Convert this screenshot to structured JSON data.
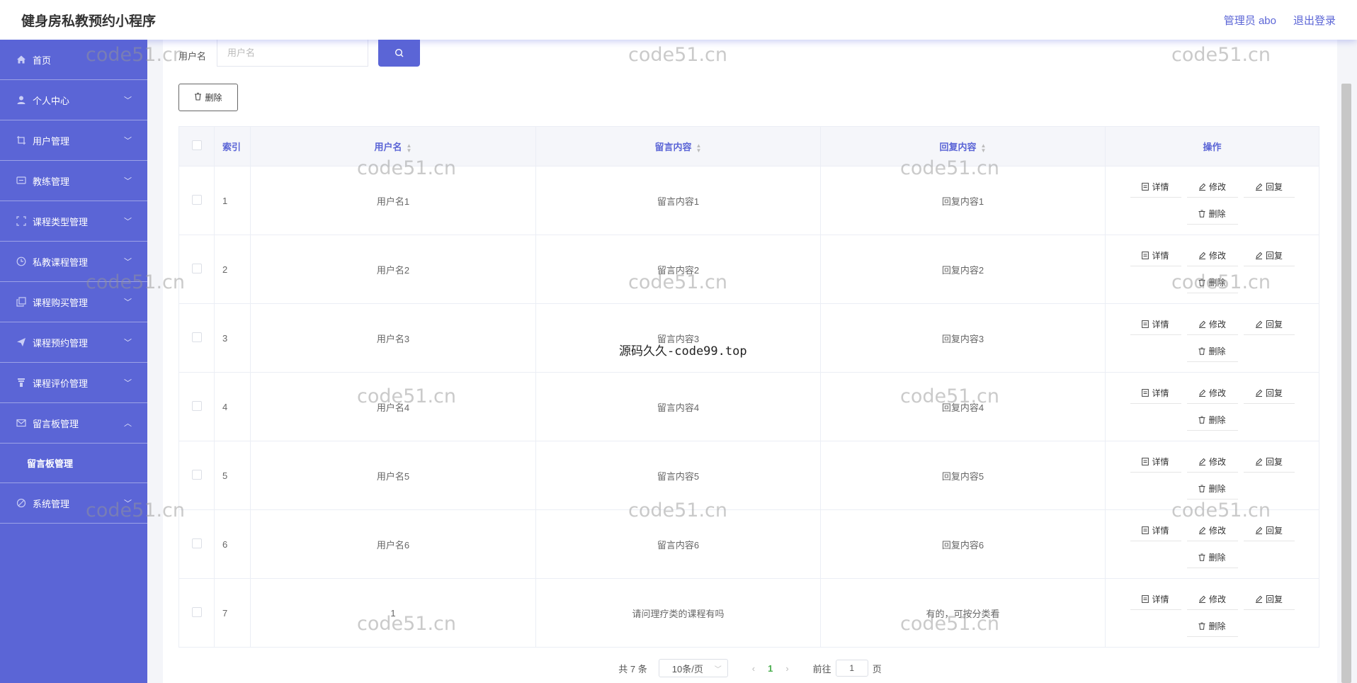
{
  "header": {
    "app_title": "健身房私教预约小程序",
    "user_label": "管理员 abo",
    "logout_label": "退出登录"
  },
  "sidebar": {
    "items": [
      {
        "label": "首页",
        "icon": "home-icon"
      },
      {
        "label": "个人中心",
        "icon": "user-icon"
      },
      {
        "label": "用户管理",
        "icon": "crop-icon"
      },
      {
        "label": "教练管理",
        "icon": "message-icon"
      },
      {
        "label": "课程类型管理",
        "icon": "fullscreen-icon"
      },
      {
        "label": "私教课程管理",
        "icon": "clock-icon"
      },
      {
        "label": "课程购买管理",
        "icon": "copy-icon"
      },
      {
        "label": "课程预约管理",
        "icon": "send-icon"
      },
      {
        "label": "课程评价管理",
        "icon": "trophy-icon"
      },
      {
        "label": "留言板管理",
        "icon": "mail-icon"
      },
      {
        "label": "系统管理",
        "icon": "setting-icon"
      }
    ],
    "submenu": {
      "label": "留言板管理"
    }
  },
  "search": {
    "label": "用户名",
    "placeholder": "用户名"
  },
  "toolbar": {
    "delete_label": "删除"
  },
  "table": {
    "columns": [
      "索引",
      "用户名",
      "留言内容",
      "回复内容",
      "操作"
    ],
    "rows": [
      {
        "index": "1",
        "username": "用户名1",
        "message": "留言内容1",
        "reply": "回复内容1"
      },
      {
        "index": "2",
        "username": "用户名2",
        "message": "留言内容2",
        "reply": "回复内容2"
      },
      {
        "index": "3",
        "username": "用户名3",
        "message": "留言内容3",
        "reply": "回复内容3"
      },
      {
        "index": "4",
        "username": "用户名4",
        "message": "留言内容4",
        "reply": "回复内容4"
      },
      {
        "index": "5",
        "username": "用户名5",
        "message": "留言内容5",
        "reply": "回复内容5"
      },
      {
        "index": "6",
        "username": "用户名6",
        "message": "留言内容6",
        "reply": "回复内容6"
      },
      {
        "index": "7",
        "username": "1",
        "message": "请问理疗类的课程有吗",
        "reply": "有的，可按分类看"
      }
    ],
    "actions": {
      "detail": "详情",
      "edit": "修改",
      "reply": "回复",
      "delete": "删除"
    }
  },
  "pagination": {
    "total": "共 7 条",
    "page_size": "10条/页",
    "current_page": "1",
    "goto_label": "前往",
    "goto_value": "1",
    "page_suffix": "页"
  },
  "watermarks": {
    "site": "code51.cn",
    "center": "源码久久-code99.top"
  },
  "colors": {
    "accent": "#5b65d6",
    "active_page": "#4caf50"
  }
}
